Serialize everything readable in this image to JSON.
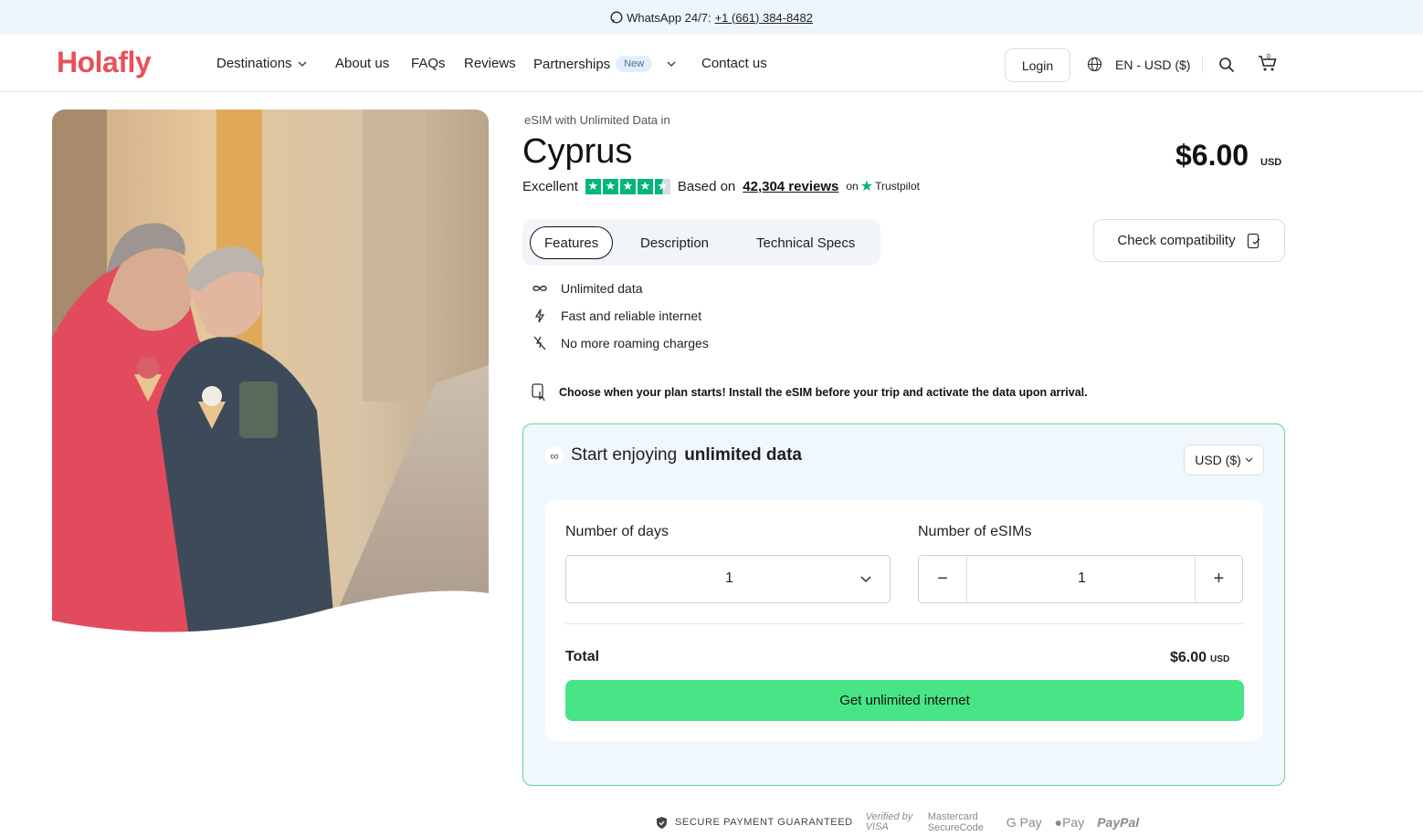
{
  "topbar": {
    "whatsapp_label": "WhatsApp 24/7:",
    "phone": "+1 (661) 384-8482"
  },
  "nav": {
    "logo": "Holafly",
    "items": [
      "Destinations",
      "About us",
      "FAQs",
      "Reviews",
      "Partnerships",
      "Contact us"
    ],
    "new_badge": "New",
    "login": "Login",
    "locale": "EN - USD ($)",
    "cart_count": "0"
  },
  "product": {
    "subtitle": "eSIM with Unlimited Data in",
    "title": "Cyprus",
    "price": "$6.00",
    "price_currency": "USD",
    "rating_word": "Excellent",
    "rating_stars": 4.5,
    "based_on": "Based on",
    "reviews_link": "42,304 reviews",
    "on": "on",
    "trustpilot": "Trustpilot"
  },
  "tabs": [
    "Features",
    "Description",
    "Technical Specs"
  ],
  "check_compat": "Check compatibility",
  "features": [
    "Unlimited data",
    "Fast and reliable internet",
    "No more roaming charges"
  ],
  "note": "Choose when your plan starts! Install the eSIM before your trip and activate the data upon arrival.",
  "plan": {
    "heading_prefix": "Start enjoying",
    "heading_bold": "unlimited data",
    "currency_select": "USD ($)",
    "days_label": "Number of days",
    "days_value": "1",
    "esims_label": "Number of eSIMs",
    "esims_value": "1",
    "total_label": "Total",
    "total_value": "$6.00",
    "total_currency": "USD",
    "cta": "Get unlimited internet"
  },
  "payment": {
    "secure": "SECURE PAYMENT GUARANTEED",
    "methods": [
      "Verified by VISA",
      "Mastercard SecureCode",
      "G Pay",
      "Pay",
      "PayPal"
    ]
  },
  "colors": {
    "brand": "#e8505b",
    "cta": "#47e586",
    "trustpilot": "#00b67a",
    "plan_border": "#6ccf94"
  }
}
